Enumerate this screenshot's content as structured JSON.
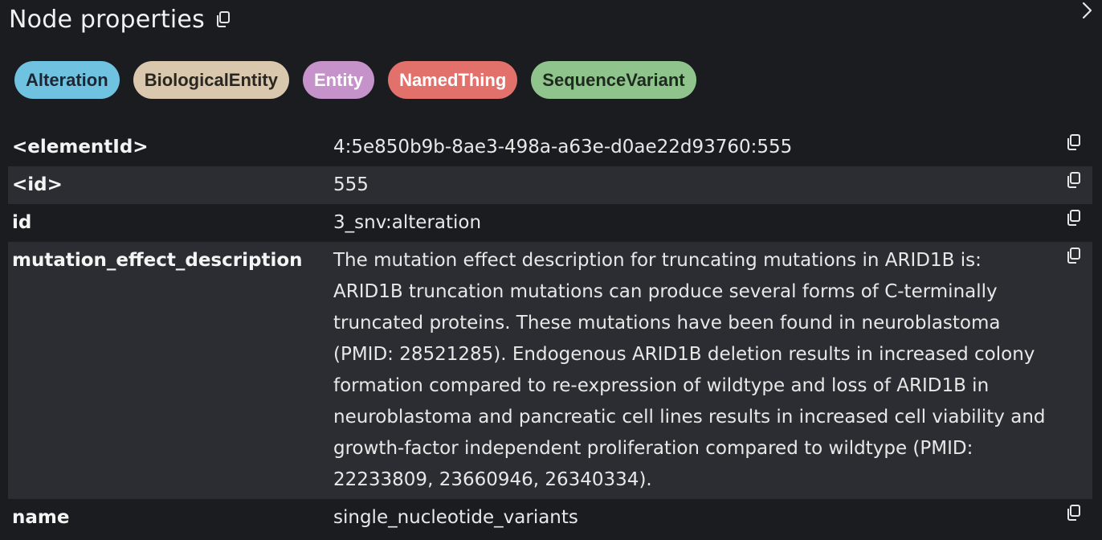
{
  "header": {
    "title": "Node properties"
  },
  "labels": [
    {
      "text": "Alteration",
      "bg": "#6fc2e0",
      "fg": "#1d2633"
    },
    {
      "text": "BiologicalEntity",
      "bg": "#d9c8ae",
      "fg": "#2a2620"
    },
    {
      "text": "Entity",
      "bg": "#c592c9",
      "fg": "#ffffff"
    },
    {
      "text": "NamedThing",
      "bg": "#e2706b",
      "fg": "#ffffff"
    },
    {
      "text": "SequenceVariant",
      "bg": "#8fc58c",
      "fg": "#1e2a1d"
    }
  ],
  "properties": [
    {
      "key": "<elementId>",
      "value": "4:5e850b9b-8ae3-498a-a63e-d0ae22d93760:555"
    },
    {
      "key": "<id>",
      "value": "555"
    },
    {
      "key": "id",
      "value": "3_snv:alteration"
    },
    {
      "key": "mutation_effect_description",
      "value": "The mutation effect description for truncating mutations in ARID1B is: ARID1B truncation mutations can produce several forms of C-terminally truncated proteins. These mutations have been found in neuroblastoma (PMID: 28521285). Endogenous ARID1B deletion results in increased colony formation compared to re-expression of wildtype and loss of ARID1B in neuroblastoma and pancreatic cell lines results in increased cell viability and growth-factor independent proliferation compared to wildtype (PMID: 22233809, 23660946, 26340334)."
    },
    {
      "key": "name",
      "value": "single_nucleotide_variants"
    }
  ],
  "icons": {
    "copy": "copy-icon",
    "chevron": "chevron-right-icon"
  }
}
